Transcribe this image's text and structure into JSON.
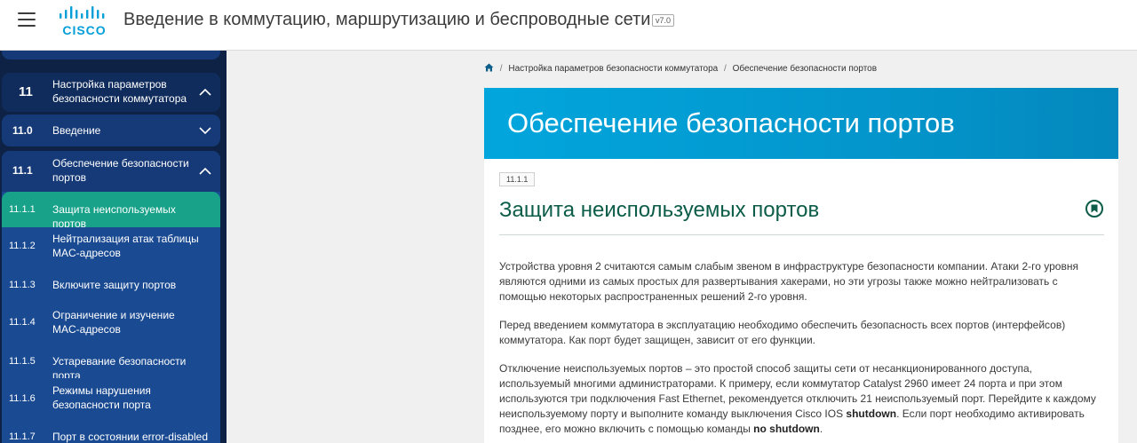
{
  "header": {
    "logo_text": "CISCO",
    "course_title": "Введение в коммутацию, маршрутизацию и беспроводные сети",
    "version": "v7.0"
  },
  "sidebar": {
    "items": [
      {
        "num": "11",
        "label": "Настройка параметров безопасности коммутатора",
        "chevron": "up",
        "level": "chapter"
      },
      {
        "num": "11.0",
        "label": "Введение",
        "chevron": "down",
        "level": "section"
      },
      {
        "num": "11.1",
        "label": "Обеспечение безопасности портов",
        "chevron": "up",
        "level": "section"
      },
      {
        "num": "11.1.1",
        "label": "Защита неиспользуемых портов",
        "level": "topic",
        "active": true
      },
      {
        "num": "11.1.2",
        "label": "Нейтрализация атак таблицы MAC-адресов",
        "level": "topic"
      },
      {
        "num": "11.1.3",
        "label": "Включите защиту портов",
        "level": "topic"
      },
      {
        "num": "11.1.4",
        "label": "Ограничение и изучение MAC-адресов",
        "level": "topic"
      },
      {
        "num": "11.1.5",
        "label": "Устаревание безопасности порта",
        "level": "topic"
      },
      {
        "num": "11.1.6",
        "label": "Режимы нарушения безопасности порта",
        "level": "topic"
      },
      {
        "num": "11.1.7",
        "label": "Порт в состоянии error-disabled",
        "level": "topic"
      }
    ]
  },
  "breadcrumb": {
    "items": [
      "Настройка параметров безопасности коммутатора",
      "Обеспечение безопасности портов"
    ]
  },
  "banner": {
    "title": "Обеспечение безопасности портов"
  },
  "topic": {
    "badge": "11.1.1",
    "title": "Защита неиспользуемых портов"
  },
  "paragraphs": {
    "p1": "Устройства уровня 2 считаются самым слабым звеном в инфраструктуре безопасности компании. Атаки 2-го уровня являются одними из самых простых для развертывания хакерами, но эти угрозы также можно нейтрализовать с помощью некоторых распространенных решений 2-го уровня.",
    "p2": "Перед введением коммутатора в эксплуатацию необходимо обеспечить безопасность всех портов (интерфейсов) коммутатора. Как порт будет защищен, зависит от его функции.",
    "p3_a": "Отключение неиспользуемых портов – это простой способ защиты сети от несанкционированного доступа, используемый многими администраторами. К примеру, если коммутатор Catalyst 2960 имеет 24 порта и при этом используются три подключения Fast Ethernet, рекомендуется отключить 21 неиспользуемый порт. Перейдите к каждому неиспользуемому порту и выполните команду выключения Cisco IOS ",
    "p3_b": "shutdown",
    "p3_c": ". Если порт необходимо активировать позднее, его можно включить с помощью команды ",
    "p3_d": "no shutdown",
    "p3_e": "."
  },
  "colors": {
    "sidebar_bg": "#0d2244",
    "active_item": "#17a289",
    "banner": "#0393c9",
    "topic_title": "#0b5c48"
  },
  "icons": [
    "menu-icon",
    "cisco-logo",
    "chevron-up-icon",
    "chevron-down-icon",
    "home-icon",
    "bookmark-icon"
  ]
}
